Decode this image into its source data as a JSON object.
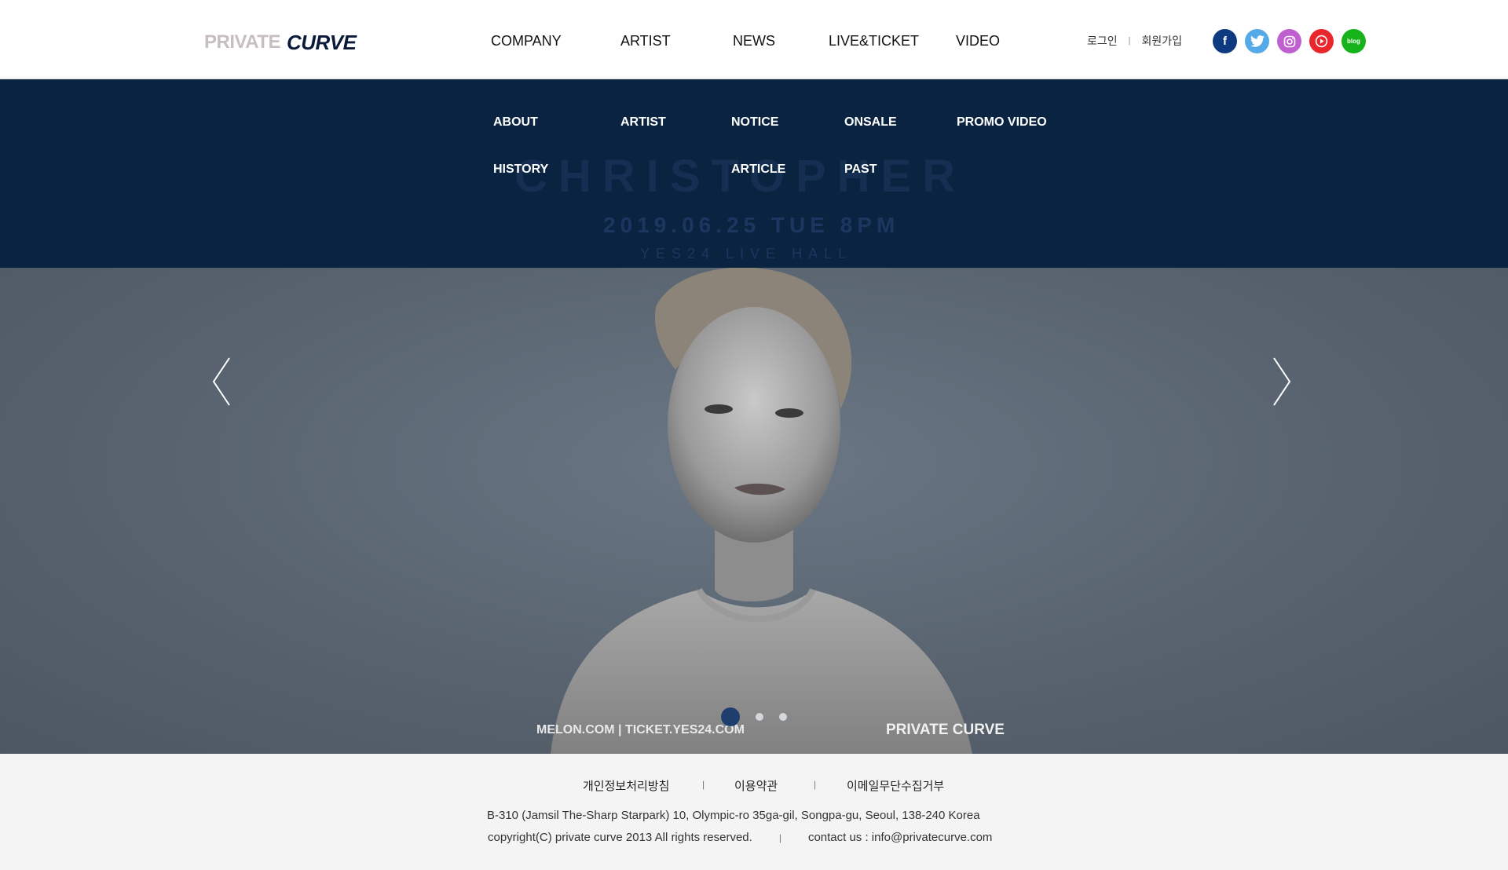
{
  "header": {
    "logo_part1": "PRIVATE",
    "logo_part2": "CURVE",
    "nav": [
      "COMPANY",
      "ARTIST",
      "NEWS",
      "LIVE&TICKET",
      "VIDEO"
    ],
    "login": "로그인",
    "signup": "회원가입",
    "sns": [
      "facebook-icon",
      "twitter-icon",
      "instagram-icon",
      "youtube-icon",
      "blog-icon"
    ],
    "blog_label": "blog"
  },
  "subnav": {
    "company": [
      "ABOUT",
      "HISTORY"
    ],
    "artist": [
      "ARTIST"
    ],
    "news": [
      "NOTICE",
      "ARTICLE"
    ],
    "live": [
      "ONSALE",
      "PAST"
    ],
    "video": [
      "PROMO VIDEO"
    ],
    "bg_title": "CHRISTOPHER",
    "bg_date": "2019.06.25 TUE 8PM",
    "bg_venue": "YES24 LIVE HALL"
  },
  "hero": {
    "sites": "MELON.COM  |  TICKET.YES24.COM",
    "brand": "PRIVATE CURVE",
    "slides": 3,
    "active_slide": 1
  },
  "footer": {
    "links": [
      "개인정보처리방침",
      "이용약관",
      "이메일무단수집거부"
    ],
    "address": "B-310 (Jamsil The-Sharp Starpark) 10, Olympic-ro 35ga-gil, Songpa-gu, Seoul, 138-240 Korea",
    "copyright": "copyright(C) private curve 2013 All rights reserved.",
    "contact": "contact us : info@privatecurve.com"
  },
  "colors": {
    "brand_navy": "#0c1a3a",
    "subnav_bg": "#0a2340",
    "active_dot": "#1e3f6d"
  }
}
